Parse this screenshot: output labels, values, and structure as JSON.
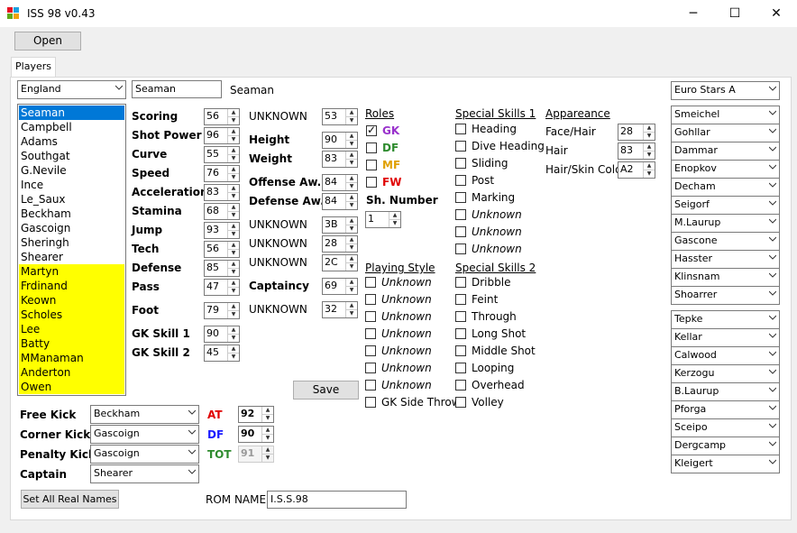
{
  "window": {
    "title": "ISS 98 v0.43",
    "minimize": "─",
    "maximize": "☐",
    "close": "✕"
  },
  "toolbar": {
    "open": "Open"
  },
  "tabs": {
    "players": "Players"
  },
  "team_select": "England",
  "player_name_input": "Seaman",
  "player_name_display": "Seaman",
  "players": [
    "Seaman",
    "Campbell",
    "Adams",
    "Southgat",
    "G.Nevile",
    "Ince",
    "Le_Saux",
    "Beckham",
    "Gascoign",
    "Sheringh",
    "Shearer",
    "Martyn",
    "Frdinand",
    "Keown",
    "Scholes",
    "Lee",
    "Batty",
    "MManaman",
    "Anderton",
    "Owen"
  ],
  "stats": [
    {
      "label": "Scoring",
      "value": "56"
    },
    {
      "label": "Shot Power",
      "value": "96"
    },
    {
      "label": "Curve",
      "value": "55"
    },
    {
      "label": "Speed",
      "value": "76"
    },
    {
      "label": "Acceleration",
      "value": "83"
    },
    {
      "label": "Stamina",
      "value": "68"
    },
    {
      "label": "Jump",
      "value": "93"
    },
    {
      "label": "Tech",
      "value": "56"
    },
    {
      "label": "Defense",
      "value": "85"
    },
    {
      "label": "Pass",
      "value": "47"
    },
    {
      "label": "Foot",
      "value": "79"
    },
    {
      "label": "GK Skill 1",
      "value": "90"
    },
    {
      "label": "GK Skill 2",
      "value": "45"
    }
  ],
  "stats2": [
    {
      "label": "UNKNOWN",
      "value": "53"
    },
    {
      "label": "Height",
      "value": "90"
    },
    {
      "label": "Weight",
      "value": "83"
    },
    {
      "label": "Offense Aw.",
      "value": "84"
    },
    {
      "label": "Defense Aw.",
      "value": "84"
    },
    {
      "label": "UNKNOWN",
      "value": "3B"
    },
    {
      "label": "UNKNOWN",
      "value": "28"
    },
    {
      "label": "UNKNOWN",
      "value": "2C"
    },
    {
      "label": "Captaincy",
      "value": "69"
    },
    {
      "label": "UNKNOWN",
      "value": "32"
    }
  ],
  "roles": {
    "title": "Roles",
    "gk": "GK",
    "df": "DF",
    "mf": "MF",
    "fw": "FW",
    "sh_number_label": "Sh. Number",
    "sh_number": "1"
  },
  "playing_style": {
    "title": "Playing Style",
    "items": [
      "Unknown",
      "Unknown",
      "Unknown",
      "Unknown",
      "Unknown",
      "Unknown",
      "Unknown",
      "GK Side Throw"
    ]
  },
  "special1": {
    "title": "Special Skills 1",
    "items": [
      "Heading",
      "Dive Heading",
      "Sliding",
      "Post",
      "Marking",
      "Unknown",
      "Unknown",
      "Unknown"
    ]
  },
  "special2": {
    "title": "Special Skills 2",
    "items": [
      "Dribble",
      "Feint",
      "Through",
      "Long Shot",
      "Middle Shot",
      "Looping",
      "Overhead",
      "Volley"
    ]
  },
  "appearance": {
    "title": "Appareance",
    "face_label": "Face/Hair",
    "face": "28",
    "hair_label": "Hair",
    "hair": "83",
    "skin_label": "Hair/Skin Color",
    "skin": "A2"
  },
  "save": "Save",
  "set_pieces": {
    "free_kick_label": "Free Kick",
    "free_kick": "Beckham",
    "corner_label": "Corner Kick",
    "corner": "Gascoign",
    "penalty_label": "Penalty Kick",
    "penalty": "Gascoign",
    "captain_label": "Captain",
    "captain": "Shearer"
  },
  "ratings": {
    "at_label": "AT",
    "at": "92",
    "df_label": "DF",
    "df": "90",
    "tot_label": "TOT",
    "tot": "91"
  },
  "set_real_names": "Set All Real Names",
  "rom_name_label": "ROM NAME",
  "rom_name": "I.S.S.98",
  "right_team": "Euro Stars A",
  "right_group1": [
    "Smeichel",
    "Gohllar",
    "Dammar",
    "Enopkov",
    "Decham",
    "Seigorf",
    "M.Laurup",
    "Gascone",
    "Hasster",
    "Klinsnam",
    "Shoarrer"
  ],
  "right_group2": [
    "Tepke",
    "Kellar",
    "Calwood",
    "Kerzogu",
    "B.Laurup",
    "Pforga",
    "Sceipo",
    "Dergcamp",
    "Kleigert"
  ],
  "colors": {
    "selected": "#0078d7",
    "yellow": "#ffff00",
    "gk": "#9932cc",
    "df": "#2e8b2e",
    "mf": "#e0a000",
    "fw": "#e00000",
    "at": "#e00000",
    "dfr": "#1a1aff",
    "tot": "#2e8b2e"
  }
}
